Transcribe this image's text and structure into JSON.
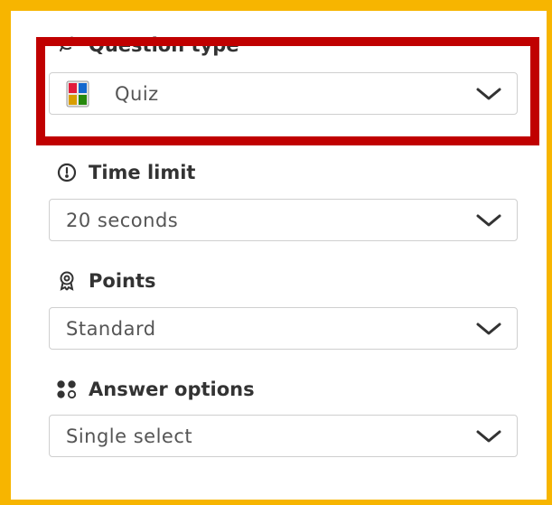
{
  "colors": {
    "frame": "#f7b500",
    "highlight": "#c00000",
    "label_text": "#333333",
    "value_text": "#555555"
  },
  "question_type": {
    "label": "Question type",
    "icon": "question-type-icon",
    "value": "Quiz",
    "value_icon": "quiz-icon"
  },
  "time_limit": {
    "label": "Time limit",
    "icon": "clock-icon",
    "value": "20 seconds"
  },
  "points": {
    "label": "Points",
    "icon": "award-icon",
    "value": "Standard"
  },
  "answer_options": {
    "label": "Answer options",
    "icon": "answer-options-icon",
    "value": "Single select"
  }
}
